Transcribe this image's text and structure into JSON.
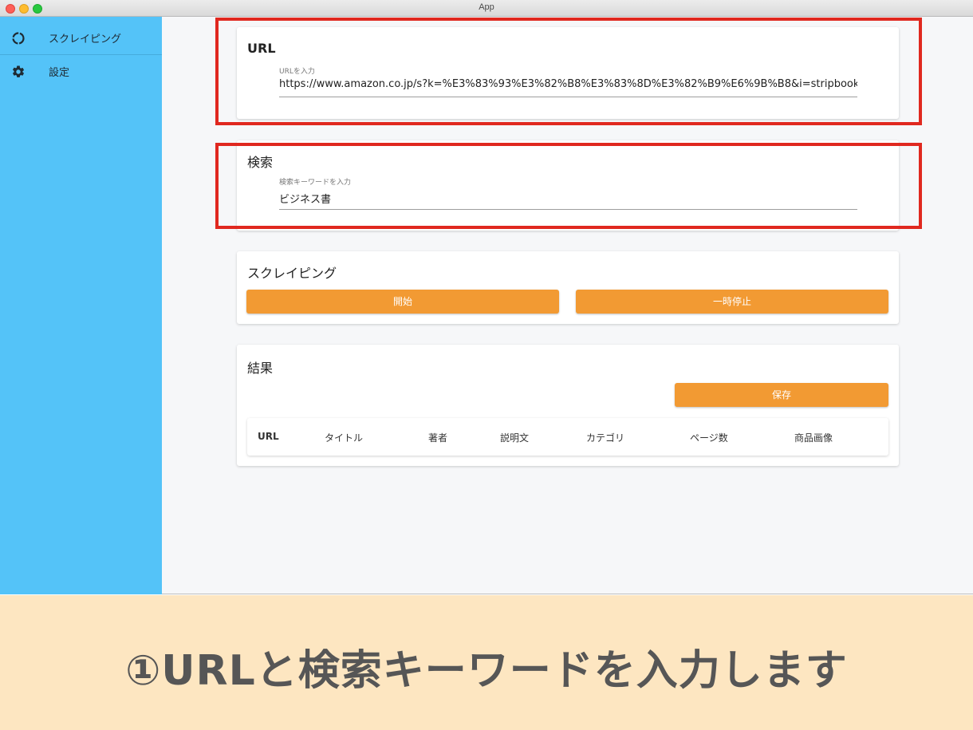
{
  "window": {
    "title": "App"
  },
  "sidebar": {
    "items": [
      {
        "label": "スクレイピング",
        "icon": "refresh-circle-icon"
      },
      {
        "label": "設定",
        "icon": "gear-icon"
      }
    ]
  },
  "url_card": {
    "title": "URL",
    "field_label": "URLを入力",
    "value": "https://www.amazon.co.jp/s?k=%E3%83%93%E3%82%B8%E3%83%8D%E3%82%B9%E6%9B%B8&i=stripbooks&__mk_ja_JP"
  },
  "search_card": {
    "title": "検索",
    "field_label": "検索キーワードを入力",
    "value": "ビジネス書"
  },
  "scraping_card": {
    "title": "スクレイピング",
    "start_label": "開始",
    "pause_label": "一時停止"
  },
  "results_card": {
    "title": "結果",
    "save_label": "保存",
    "columns": [
      "URL",
      "タイトル",
      "著者",
      "説明文",
      "カテゴリ",
      "ページ数",
      "商品画像"
    ]
  },
  "caption": {
    "text": "①URLと検索キーワードを入力します"
  },
  "colors": {
    "sidebar": "#54c3f8",
    "button": "#f29a33",
    "highlight": "#e0281f",
    "caption_bg": "#fde6c1"
  }
}
